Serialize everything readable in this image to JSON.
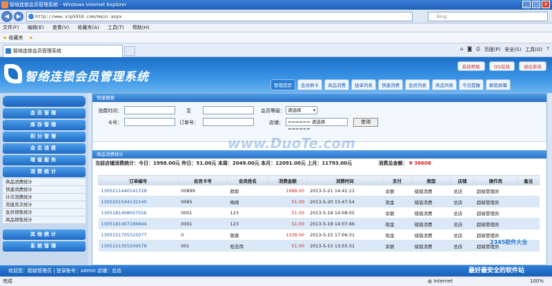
{
  "window": {
    "title": "智络连锁会员管理系统 - Windows Internet Explorer"
  },
  "address": {
    "url": "http://www.vip5918.com/main.aspx",
    "search_placeholder": "Bing"
  },
  "menu": [
    "文件(F)",
    "编辑(E)",
    "查看(V)",
    "收藏夹(A)",
    "工具(T)",
    "帮助(H)"
  ],
  "favorites": {
    "label": "收藏夹"
  },
  "tab": {
    "title": "智络连锁会员管理系统"
  },
  "commands": [
    "页面(P)",
    "安全(S)",
    "工具(O)"
  ],
  "header": {
    "system_name": "智络连锁会员管理系统",
    "top_buttons": [
      "系统帮助",
      "QQ在线",
      "退出系统"
    ],
    "nav_tabs": [
      "管理首页",
      "会员刷卡",
      "商品消费",
      "挂单列表",
      "快速消费",
      "会员列表",
      "商品列表",
      "今日提醒",
      "解锁屏幕"
    ]
  },
  "sidebar": {
    "items": [
      "会员管理",
      "库存管理",
      "积分管理",
      "会员消费",
      "增值服务",
      "消费统计"
    ],
    "sub_items": [
      "商品消费统计",
      "快速消费统计",
      "计次消费统计",
      "充值充次统计",
      "会员销售统计",
      "商品销售统计"
    ],
    "bottom_items": [
      "其他统计",
      "系统管理"
    ]
  },
  "search_form": {
    "title": "快速搜索",
    "time_label": "消费时间：",
    "to_label": "至",
    "level_label": "会员等级：",
    "level_value": "请选择",
    "card_label": "卡号：",
    "order_label": "订单号：",
    "store_label": "店铺：",
    "store_value": "====== 请选择 ======",
    "query_button": "查询"
  },
  "stats": {
    "title": "商品消费统计",
    "summary": "当前店铺消费统计：今日：1998.00元 昨日：51.00元 本周：2049.00元 本月：12091.00元 上月：11793.00元",
    "total_label": "消费总金额：",
    "total_value": "¥ 36608"
  },
  "table": {
    "headers": [
      "订单编号",
      "会员卡号",
      "会员姓名",
      "消费金额",
      "消费时间",
      "支付",
      "类型",
      "店铺",
      "操作员",
      "备注"
    ],
    "rows": [
      [
        "1305211440141728",
        "00899",
        "欧耶",
        "1998.00",
        "2013-5-21 14:41:11",
        "余额",
        "储值消费",
        "总店",
        "超级管理员",
        ""
      ],
      [
        "1305201544132140",
        "0065",
        "杨硕",
        "51.00",
        "2013-5-20 15:47:54",
        "现金",
        "储值消费",
        "总店",
        "超级管理员",
        ""
      ],
      [
        "1305181408057556",
        "0001",
        "123",
        "51.00",
        "2013-5-18 14:08:05",
        "余额",
        "储值消费",
        "总店",
        "超级管理员",
        ""
      ],
      [
        "1305181407186844",
        "0001",
        "123",
        "51.00",
        "2013-5-18 14:07:46",
        "现金",
        "储值消费",
        "总店",
        "超级管理员",
        ""
      ],
      [
        "1305151705525077",
        "0",
        "散客",
        "1338.00",
        "2013-5-15 17:06:31",
        "现金",
        "储值消费",
        "总店",
        "超级管理员",
        ""
      ],
      [
        "1305151355209578",
        "001",
        "程志伟",
        "51.00",
        "2013-5-15 13:55:31",
        "余额",
        "储值消费",
        "总店",
        "超级管理员",
        ""
      ]
    ]
  },
  "footer": {
    "text": "欢迎您：超级管理员 | 登录账号：admin 店铺：总店",
    "slogan": "最好最安全的软件站"
  },
  "status": {
    "left": "完成",
    "zone": "Internet",
    "zoom": "100%"
  },
  "watermark": {
    "main": "www.DuoTe.com",
    "sub": "2345软件大全"
  }
}
